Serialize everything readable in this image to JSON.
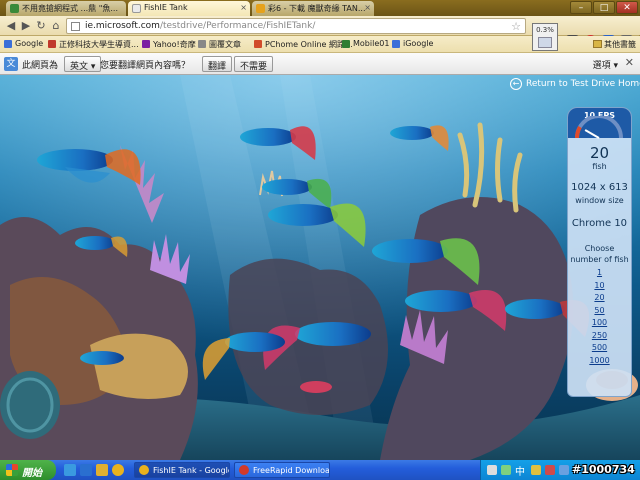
{
  "tabs": [
    {
      "label": "不用竟搶網程式 ...鼎 \"魚...",
      "favicon_color": "#3a8a3a"
    },
    {
      "label": "FishIE Tank",
      "favicon_color": "#eaeaea",
      "active": true
    },
    {
      "label": "彩6 - 下載 魔獸奇緣 TAN...",
      "favicon_color": "#e6a21c"
    }
  ],
  "window_buttons": {
    "minimize": "–",
    "maximize": "□",
    "close": "✕"
  },
  "address_bar": {
    "url_host": "ie.microsoft.com",
    "url_path": "/testdrive/Performance/FishIETank/",
    "zoom": "0.3%"
  },
  "nav": {
    "back": "◀",
    "forward": "▶",
    "reload": "↻",
    "home": "⌂"
  },
  "bookmarks": [
    {
      "label": "Google",
      "color": "#3b6fd8"
    },
    {
      "label": "正修科技大學生導資...",
      "color": "#c0392b"
    },
    {
      "label": "Yahoo!奇摩",
      "color": "#7b1fa2"
    },
    {
      "label": "圖覆文章",
      "color": "#888888"
    },
    {
      "label": "PChome Online 網路...",
      "color": "#d14b2a"
    },
    {
      "label": "Mobile01",
      "color": "#2e7d32"
    },
    {
      "label": "iGoogle",
      "color": "#3b6fd8"
    }
  ],
  "other_bookmarks": "其他書籤",
  "translate_bar": {
    "page_is_in": "此網頁為",
    "language": "英文 ▾",
    "question": "您要翻譯網頁內容嗎？",
    "translate_button": "翻譯",
    "no_button": "不需要",
    "options": "選項 ▾",
    "close": "✕"
  },
  "page": {
    "return_link": "Return to Test Drive Home",
    "fps_label": "10 FPS",
    "fps_value": 10,
    "fish_count": "20",
    "fish_label": "fish",
    "window_size": "1024 x 613",
    "window_size_label": "window size",
    "browser": "Chrome 10",
    "choose_label": "Choose number of fish",
    "fish_options": [
      "1",
      "10",
      "20",
      "50",
      "100",
      "250",
      "500",
      "1000"
    ]
  },
  "taskbar": {
    "start_label": "開始",
    "buttons": [
      {
        "label": "FishIE Tank - Google ...",
        "icon_color": "#e8b21f",
        "active": true
      },
      {
        "label": "FreeRapid Downloade...",
        "icon_color": "#d23a2a"
      }
    ],
    "ime": "中",
    "watermark": "#1000734"
  }
}
